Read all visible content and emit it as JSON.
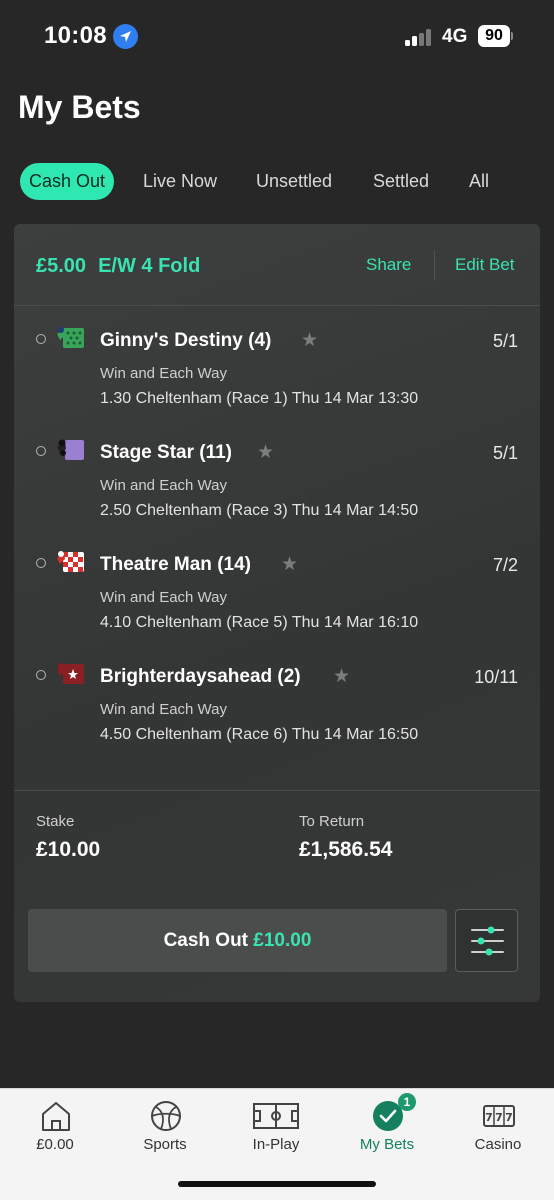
{
  "status_bar": {
    "time": "10:08",
    "network": "4G",
    "battery": "90"
  },
  "page": {
    "title": "My Bets"
  },
  "tabs": [
    {
      "label": "Cash Out",
      "active": true
    },
    {
      "label": "Live Now",
      "active": false
    },
    {
      "label": "Unsettled",
      "active": false
    },
    {
      "label": "Settled",
      "active": false
    },
    {
      "label": "All",
      "active": false
    }
  ],
  "bet": {
    "stake_title": "£5.00",
    "bet_type": "E/W 4 Fold",
    "share_label": "Share",
    "edit_label": "Edit Bet",
    "selections": [
      {
        "name": "Ginny's Destiny (4)",
        "odds": "5/1",
        "market": "Win and Each Way",
        "race": "1.30 Cheltenham (Race 1)   Thu 14 Mar 13:30"
      },
      {
        "name": "Stage Star (11)",
        "odds": "5/1",
        "market": "Win and Each Way",
        "race": "2.50 Cheltenham (Race 3)   Thu 14 Mar 14:50"
      },
      {
        "name": "Theatre Man (14)",
        "odds": "7/2",
        "market": "Win and Each Way",
        "race": "4.10 Cheltenham (Race 5)   Thu 14 Mar 16:10"
      },
      {
        "name": "Brighterdaysahead (2)",
        "odds": "10/11",
        "market": "Win and Each Way",
        "race": "4.50 Cheltenham (Race 6)   Thu 14 Mar 16:50"
      }
    ],
    "stake_label": "Stake",
    "stake_value": "£10.00",
    "return_label": "To Return",
    "return_value": "£1,586.54",
    "cashout_label": "Cash Out",
    "cashout_amount": "£10.00"
  },
  "nav": {
    "items": [
      {
        "label": "£0.00",
        "icon": "home-icon"
      },
      {
        "label": "Sports",
        "icon": "football-icon"
      },
      {
        "label": "In-Play",
        "icon": "pitch-icon"
      },
      {
        "label": "My Bets",
        "icon": "check-circle-icon",
        "badge": "1",
        "active": true
      },
      {
        "label": "Casino",
        "icon": "slot-machine-icon"
      }
    ]
  },
  "colors": {
    "accent": "#39e3b0",
    "background": "#272727",
    "active_nav": "#14805e"
  }
}
